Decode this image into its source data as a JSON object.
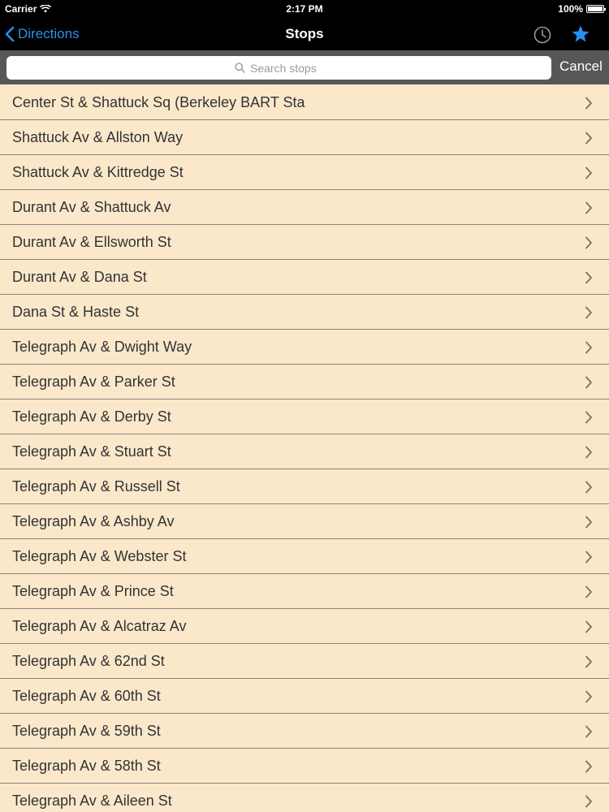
{
  "status": {
    "carrier": "Carrier",
    "time": "2:17 PM",
    "battery": "100%"
  },
  "nav": {
    "back_label": "Directions",
    "title": "Stops",
    "accent_color": "#2a8ff2"
  },
  "search": {
    "placeholder": "Search stops",
    "value": "",
    "cancel_label": "Cancel"
  },
  "stops": [
    "Center St & Shattuck Sq (Berkeley BART Sta",
    "Shattuck Av & Allston Way",
    "Shattuck Av & Kittredge St",
    "Durant Av & Shattuck Av",
    "Durant Av & Ellsworth St",
    "Durant Av & Dana St",
    "Dana St & Haste St",
    "Telegraph Av & Dwight Way",
    "Telegraph Av & Parker St",
    "Telegraph Av & Derby St",
    "Telegraph Av & Stuart St",
    "Telegraph Av & Russell St",
    "Telegraph Av & Ashby Av",
    "Telegraph Av & Webster St",
    "Telegraph Av & Prince St",
    "Telegraph Av & Alcatraz Av",
    "Telegraph Av & 62nd St",
    "Telegraph Av & 60th St",
    "Telegraph Av & 59th St",
    "Telegraph Av & 58th St",
    "Telegraph Av & Aileen St"
  ],
  "icons": {
    "wifi": "wifi-icon",
    "back": "chevron-left-icon",
    "history": "clock-icon",
    "favorites": "star-icon",
    "search": "search-icon",
    "row_disclosure": "chevron-right-icon"
  }
}
